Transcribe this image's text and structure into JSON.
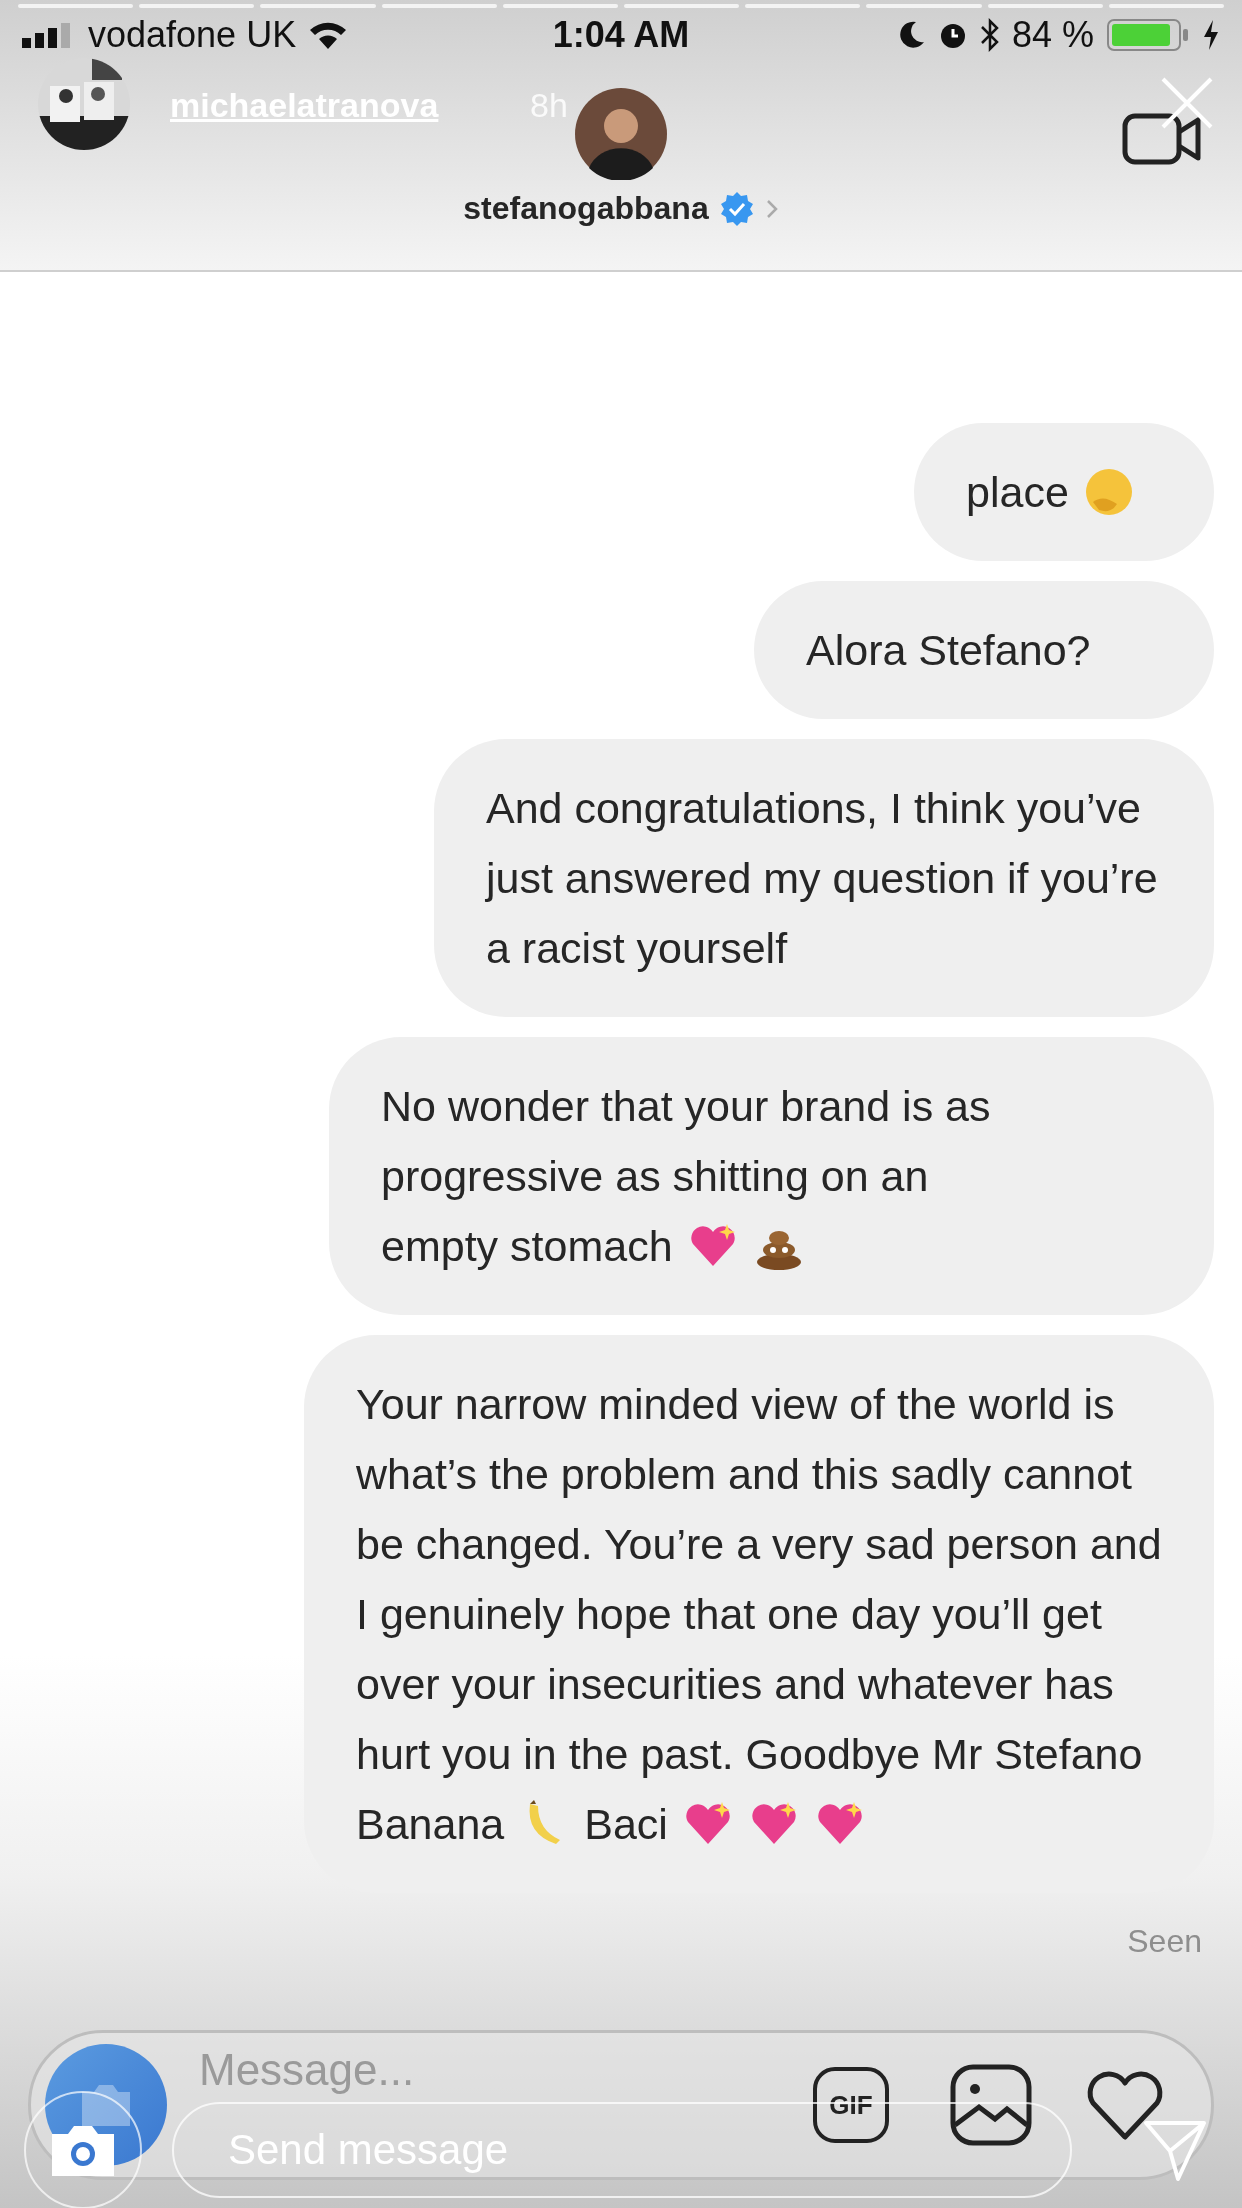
{
  "status_bar": {
    "carrier": "vodafone UK",
    "time": "1:04 AM",
    "battery": "84 %"
  },
  "story": {
    "username": "michaelatranova",
    "age": "8h",
    "reply_placeholder": "Send message"
  },
  "chat": {
    "contact": "stefanogabbana",
    "verified": true
  },
  "messages": [
    {
      "lines": [
        [
          {
            "kind": "text",
            "text": "place"
          },
          {
            "kind": "thinking"
          }
        ]
      ]
    },
    {
      "lines": [
        [
          {
            "kind": "text",
            "text": "Alora Stefano?"
          }
        ]
      ]
    },
    {
      "lines": [
        [
          {
            "kind": "text",
            "text": "And congratulations, I think you’ve just answered my question if you’re a racist yourself"
          }
        ]
      ]
    },
    {
      "lines": [
        [
          {
            "kind": "text",
            "text": "No wonder that your brand is as progressive as shitting on an"
          }
        ],
        [
          {
            "kind": "text",
            "text": "empty stomach"
          },
          {
            "kind": "sparkleheart"
          },
          {
            "kind": "poop"
          }
        ]
      ]
    },
    {
      "lines": [
        [
          {
            "kind": "text",
            "text": "Your narrow minded view of the world is what’s the problem and this sadly cannot be changed. You’re a very sad person and I genuinely hope that one day you’ll get over your insecurities and whatever has hurt you in the past. Goodbye Mr Stefano"
          }
        ],
        [
          {
            "kind": "text",
            "text": "Banana"
          },
          {
            "kind": "banana"
          },
          {
            "kind": "text",
            "text": "Baci"
          },
          {
            "kind": "sparkleheart"
          },
          {
            "kind": "sparkleheart"
          },
          {
            "kind": "sparkleheart"
          }
        ]
      ]
    }
  ],
  "seen": "Seen",
  "composer": {
    "placeholder": "Message...",
    "gif": "GIF"
  }
}
